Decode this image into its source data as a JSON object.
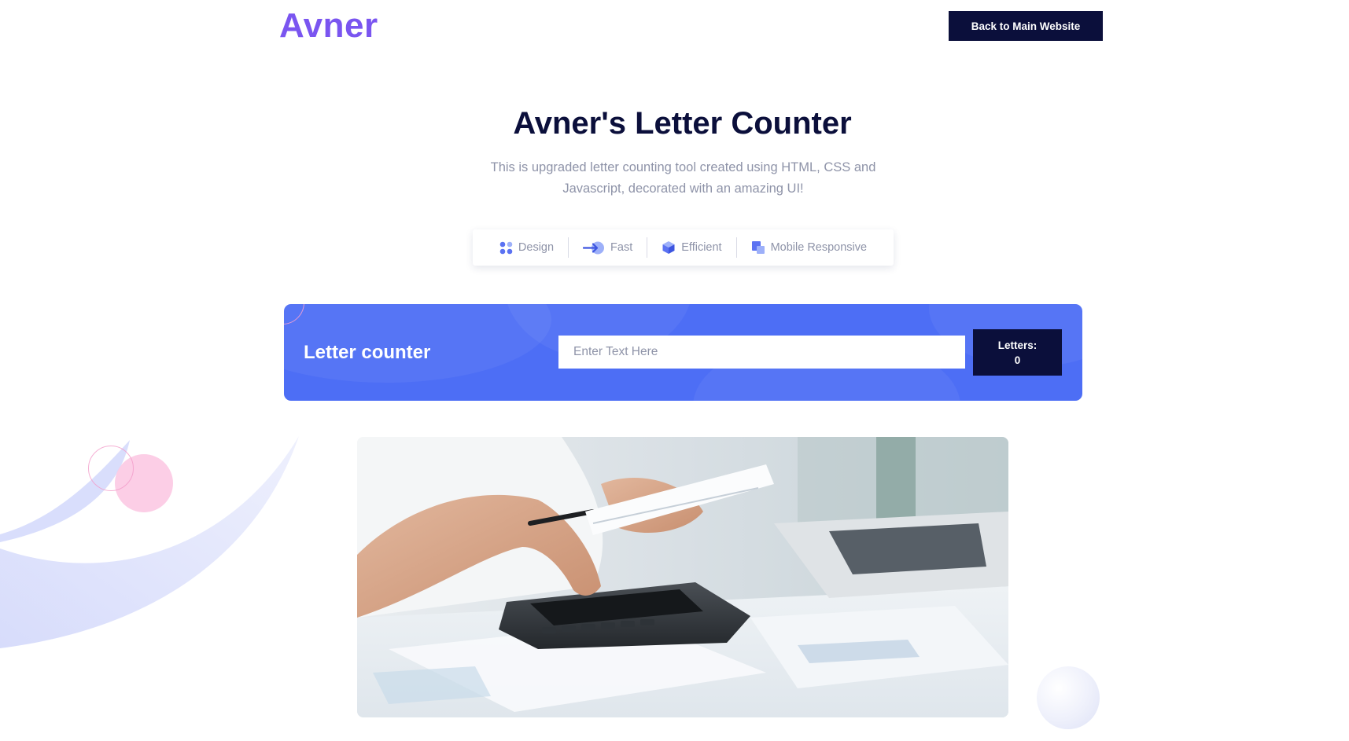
{
  "brand": {
    "logo_text": "Avner",
    "logo_color": "#7a55f0"
  },
  "header": {
    "back_button_label": "Back to Main Website"
  },
  "hero": {
    "title": "Avner's Letter Counter",
    "subtitle": "This is upgraded letter counting tool created using HTML, CSS and Javascript, decorated with an amazing UI!"
  },
  "features": [
    {
      "label": "Design",
      "icon": "dots-grid-icon"
    },
    {
      "label": "Fast",
      "icon": "arrow-right-icon"
    },
    {
      "label": "Efficient",
      "icon": "cube-icon"
    },
    {
      "label": "Mobile Responsive",
      "icon": "devices-icon"
    }
  ],
  "counter": {
    "title": "Letter counter",
    "input_value": "",
    "input_placeholder": "Enter Text Here",
    "count_label": "Letters:",
    "count_value": "0"
  },
  "photo": {
    "icon": "calculator-photo"
  },
  "colors": {
    "accent": "#4d6ef5",
    "dark": "#0b0f3b",
    "muted_text": "#8e93a8",
    "pink": "#fbc6e2"
  }
}
